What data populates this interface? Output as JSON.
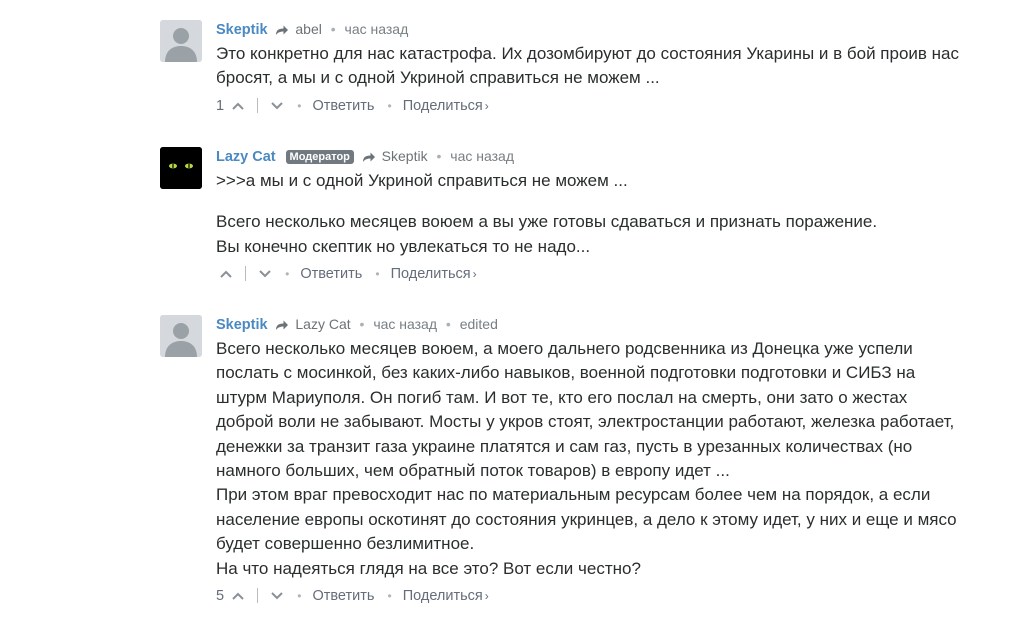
{
  "comments": [
    {
      "author": "Skeptik",
      "parent": "abel",
      "time": "час назад",
      "edited": "",
      "badge": "",
      "paragraphs": [
        "Это конкретно для нас катастрофа. Их дозомбируют до состояния Укарины и в бой проив нас бросят, а мы и с одной Укриной справиться не можем ..."
      ],
      "upvotes": "1",
      "reply_label": "Ответить",
      "share_label": "Поделиться"
    },
    {
      "author": "Lazy Cat",
      "parent": "Skeptik",
      "time": "час назад",
      "edited": "",
      "badge": "Модератор",
      "paragraphs": [
        ">>>а мы и с одной Укриной справиться не можем ...",
        "",
        "Всего несколько месяцев воюем а вы уже готовы сдаваться и признать поражение.",
        "Вы конечно скептик но увлекаться то не надо..."
      ],
      "upvotes": "",
      "reply_label": "Ответить",
      "share_label": "Поделиться"
    },
    {
      "author": "Skeptik",
      "parent": "Lazy Cat",
      "time": "час назад",
      "edited": "edited",
      "badge": "",
      "paragraphs": [
        "Всего несколько месяцев воюем, а моего дальнего родсвенника из Донецка уже успели послать с мосинкой, без каких-либо навыков, военной подготовки подготовки и СИБЗ на штурм Мариуполя. Он погиб там. И вот те, кто его послал на смерть, они зато о жестах доброй воли не забывают. Мосты у укров стоят, электростанции работают, железка работает, денежки за транзит газа украине платятся и сам газ, пусть в урезанных количествах (но намного больших, чем обратный поток товаров) в европу идет ...",
        "При этом враг превосходит нас по материальным ресурсам более чем на порядок, а если население европы оскотинят до состояния укринцев, а дело к этому идет, у них и еще и мясо будет совершенно безлимитное.",
        "На что надеяться глядя на все это? Вот если честно?"
      ],
      "upvotes": "5",
      "reply_label": "Ответить",
      "share_label": "Поделиться"
    }
  ],
  "colors": {
    "author": "#4a89c2",
    "text": "#2a2e2e",
    "meta": "#777f84",
    "badge": "#717a80"
  },
  "icons": [
    "reply-arrow-icon",
    "upvote-chevron-icon",
    "downvote-chevron-icon",
    "default-avatar-icon",
    "cat-eyes-avatar"
  ]
}
